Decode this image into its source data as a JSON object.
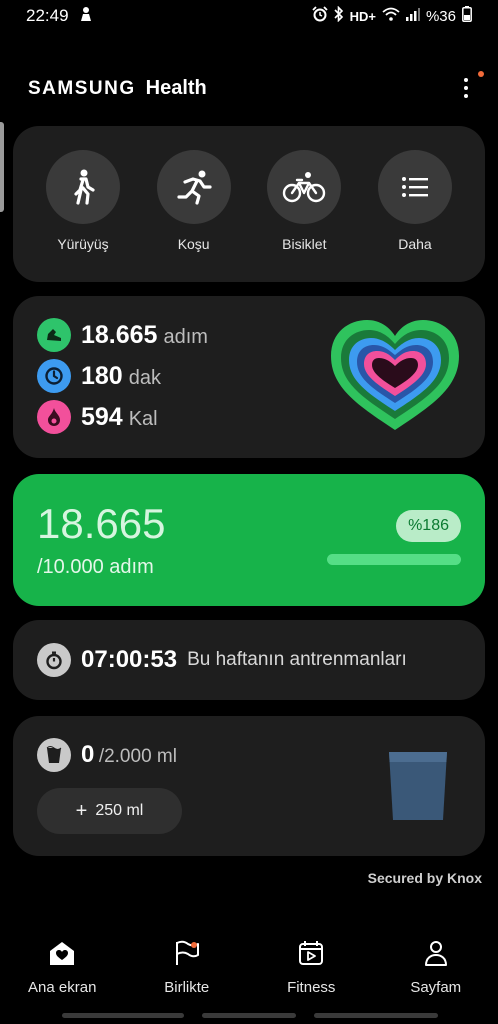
{
  "status_bar": {
    "time": "22:49",
    "network": "HD+",
    "battery": "%36",
    "icons": [
      "person-notification-icon",
      "alarm-icon",
      "bluetooth-icon",
      "wifi-icon",
      "signal-icon",
      "battery-icon"
    ]
  },
  "header": {
    "brand_samsung": "SAMSUNG",
    "brand_health": "Health"
  },
  "activities": [
    {
      "label": "Yürüyüş",
      "icon": "walking-icon"
    },
    {
      "label": "Koşu",
      "icon": "running-icon"
    },
    {
      "label": "Bisiklet",
      "icon": "bicycle-icon"
    },
    {
      "label": "Daha",
      "icon": "list-icon"
    }
  ],
  "summary": {
    "steps_value": "18.665",
    "steps_unit": "adım",
    "minutes_value": "180",
    "minutes_unit": "dak",
    "calories_value": "594",
    "calories_unit": "Kal"
  },
  "steps_card": {
    "steps": "18.665",
    "goal": "/10.000 adım",
    "percent_label": "%186",
    "progress_fraction": 1.0
  },
  "training": {
    "time": "07:00:53",
    "label": "Bu haftanın antrenmanları"
  },
  "water": {
    "value": "0",
    "goal": "/2.000 ml",
    "add_button": "250 ml"
  },
  "footer": {
    "secured": "Secured by Knox"
  },
  "nav": [
    {
      "label": "Ana ekran",
      "icon": "home-icon"
    },
    {
      "label": "Birlikte",
      "icon": "flag-icon"
    },
    {
      "label": "Fitness",
      "icon": "calendar-play-icon"
    },
    {
      "label": "Sayfam",
      "icon": "person-icon"
    }
  ],
  "colors": {
    "accent_green": "#17b34a",
    "steps_icon": "#2ec46b",
    "minutes_icon": "#3d9bf0",
    "calories_icon": "#f2509b"
  }
}
